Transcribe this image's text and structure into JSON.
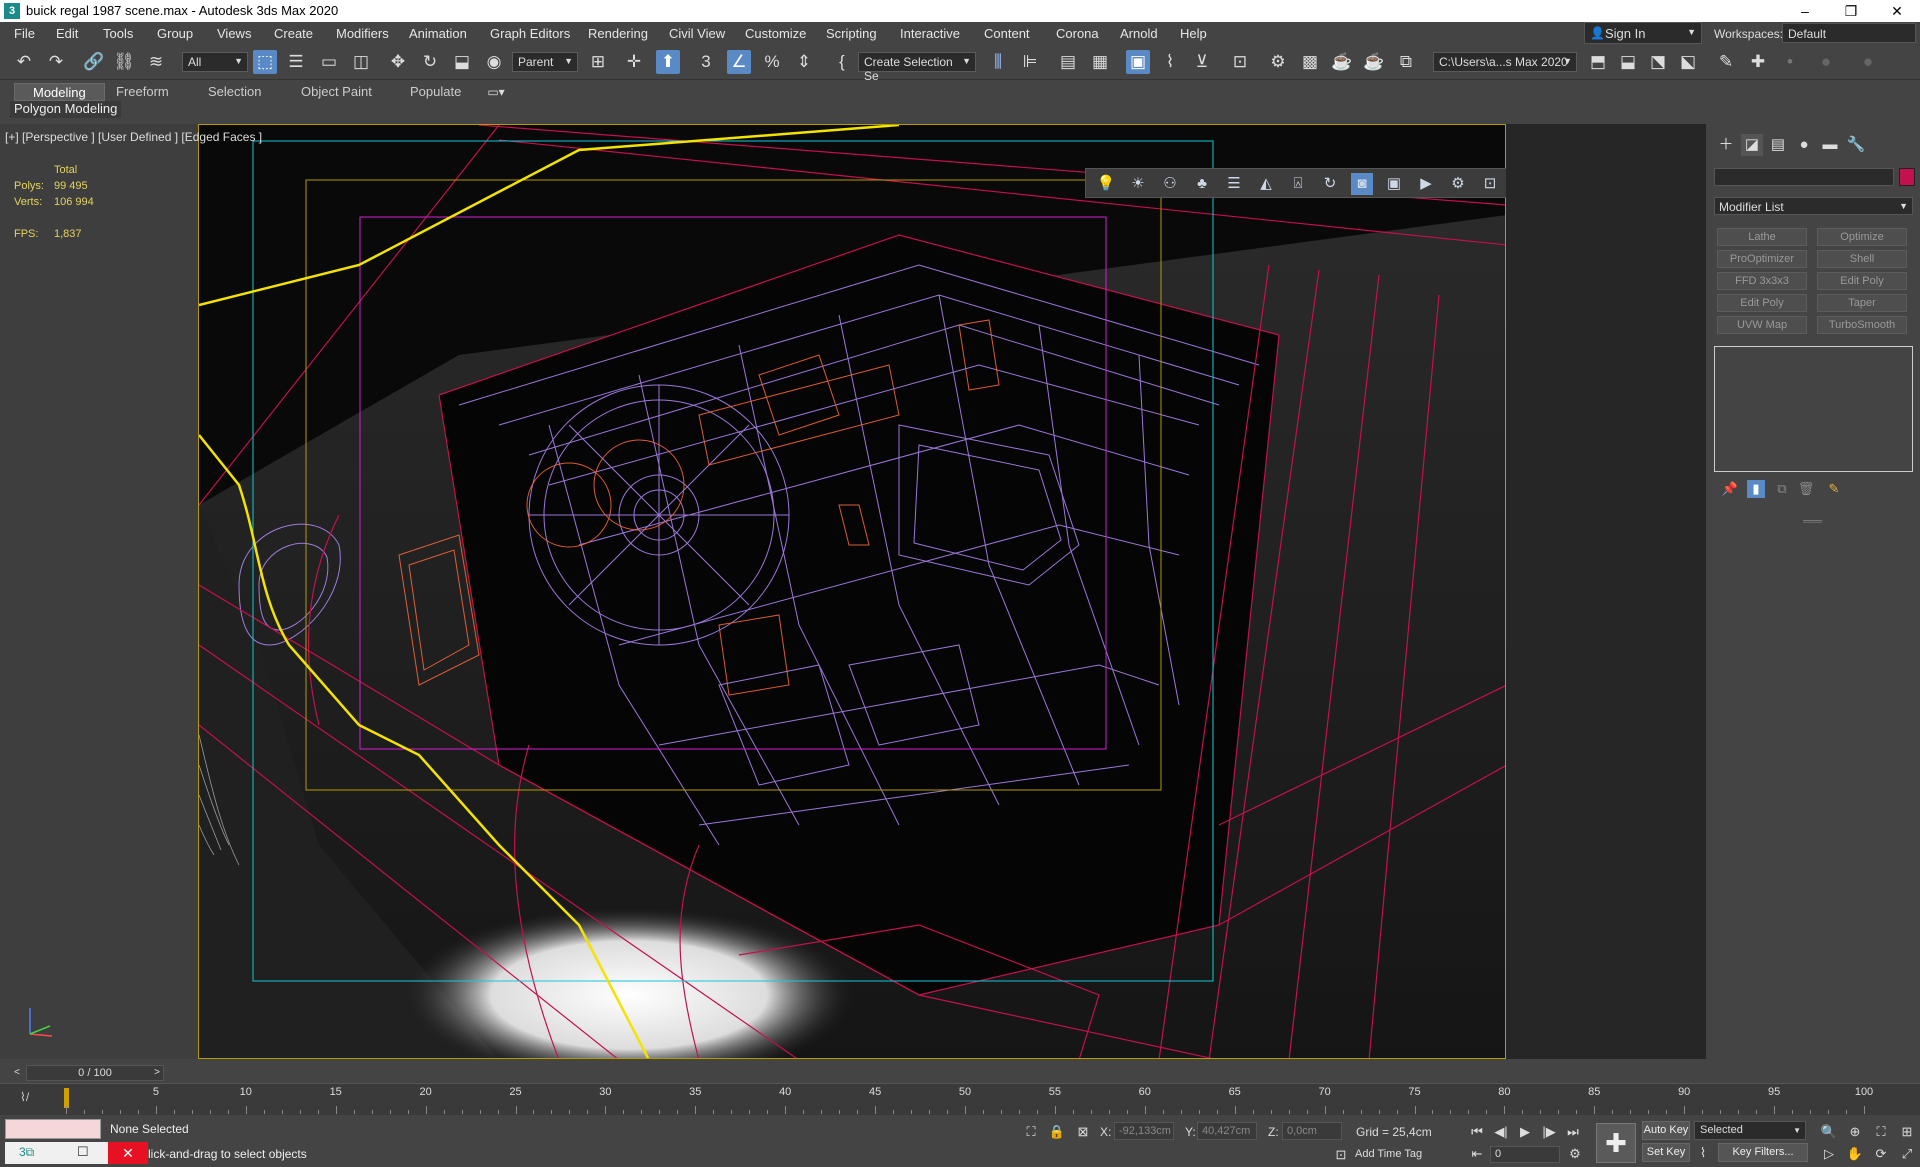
{
  "window": {
    "title": "buick regal 1987 scene.max - Autodesk 3ds Max 2020",
    "app_icon": "3ds-max-icon",
    "minimize": "–",
    "maximize": "❐",
    "close": "✕"
  },
  "menu": {
    "items": [
      "File",
      "Edit",
      "Tools",
      "Group",
      "Views",
      "Create",
      "Modifiers",
      "Animation",
      "Graph Editors",
      "Rendering",
      "Civil View",
      "Customize",
      "Scripting",
      "Interactive",
      "Content",
      "Corona",
      "Arnold",
      "Help"
    ],
    "sign_in": "Sign In",
    "workspaces_label": "Workspaces:",
    "workspace": "Default"
  },
  "toolbar": {
    "selection_filter": "All",
    "reference_coord": "Parent",
    "named_selection": "Create Selection Se",
    "project_path": "C:\\Users\\a...s Max 2020"
  },
  "ribbon": {
    "tabs": [
      "Modeling",
      "Freeform",
      "Selection",
      "Object Paint",
      "Populate"
    ],
    "active_tab": "Modeling",
    "panel": "Polygon Modeling"
  },
  "viewport": {
    "label": "[+] [Perspective ] [User Defined ] [Edged Faces ]",
    "stats": {
      "header": "Total",
      "polys_label": "Polys:",
      "polys": "99 495",
      "verts_label": "Verts:",
      "verts": "106 994",
      "fps_label": "FPS:",
      "fps": "1,837"
    }
  },
  "command_panel": {
    "modifier_list": "Modifier List",
    "modifiers": [
      "Lathe",
      "Optimize",
      "ProOptimizer",
      "Shell",
      "FFD 3x3x3",
      "Edit Poly",
      "Edit Poly",
      "Taper",
      "UVW Map",
      "TurboSmooth"
    ],
    "object_color": "#c4104e"
  },
  "timeline": {
    "slider": "0 / 100",
    "ticks": [
      "5",
      "10",
      "15",
      "20",
      "25",
      "30",
      "35",
      "40",
      "45",
      "50",
      "55",
      "60",
      "65",
      "70",
      "75",
      "80",
      "85",
      "90",
      "95",
      "100"
    ]
  },
  "status": {
    "selection": "None Selected",
    "prompt": "lick-and-drag to select objects",
    "x_label": "X:",
    "x": "-92,133cm",
    "y_label": "Y:",
    "y": "40,427cm",
    "z_label": "Z:",
    "z": "0,0cm",
    "grid": "Grid = 25,4cm",
    "add_time_tag": "Add Time Tag",
    "auto_key": "Auto Key",
    "set_key": "Set Key",
    "selected": "Selected",
    "key_filters": "Key Filters...",
    "frame": "0"
  }
}
